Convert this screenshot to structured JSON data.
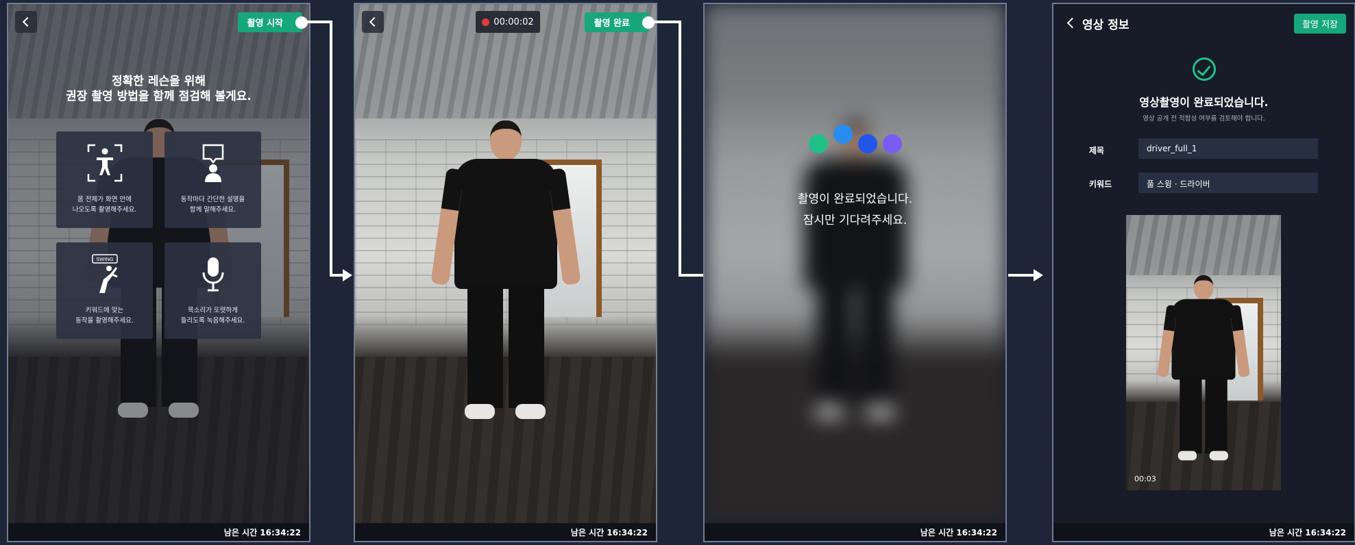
{
  "panel1": {
    "record_start_label": "촬영 시작",
    "guide_line1": "정확한 레슨을 위해",
    "guide_line2": "권장 촬영 방법을 함께 점검해 볼게요.",
    "cards": [
      {
        "line1": "몸 전체가 화면 안에",
        "line2": "나오도록 촬영해주세요.",
        "icon": "full-body-frame-icon"
      },
      {
        "line1": "동작마다 간단한 설명을",
        "line2": "함께 말해주세요.",
        "icon": "speech-person-icon"
      },
      {
        "line1": "키워드에 맞는",
        "line2": "동작을 촬영해주세요.",
        "icon": "golf-swing-icon",
        "badge": "SWING"
      },
      {
        "line1": "목소리가 또렷하게",
        "line2": "들리도록 녹음해주세요.",
        "icon": "microphone-icon"
      }
    ],
    "remaining_time": "남은 시간 16:34:22"
  },
  "panel2": {
    "timer": "00:00:02",
    "record_done_label": "촬영 완료",
    "remaining_time": "남은 시간 16:34:22"
  },
  "panel3": {
    "loading_line1": "촬영이 완료되었습니다.",
    "loading_line2": "잠시만 기다려주세요.",
    "loader_colors": [
      "#1fbf88",
      "#2a8cf0",
      "#2356e6",
      "#7a5cf5"
    ],
    "remaining_time": "남은 시간 16:34:22"
  },
  "panel4": {
    "title": "영상 정보",
    "save_label": "촬영 저장",
    "done_title": "영상촬영이 완료되었습니다.",
    "done_sub": "영상 공개 전 적합성 여부를 검토해야 합니다.",
    "title_label": "제목",
    "title_value": "driver_full_1",
    "keyword_label": "키워드",
    "keyword_value": "풀 스윙 · 드라이버",
    "video_duration": "00:03",
    "remaining_time": "남은 시간 16:34:22"
  },
  "colors": {
    "accent": "#18a67b",
    "record": "#e23b3b",
    "background": "#1d2536"
  }
}
